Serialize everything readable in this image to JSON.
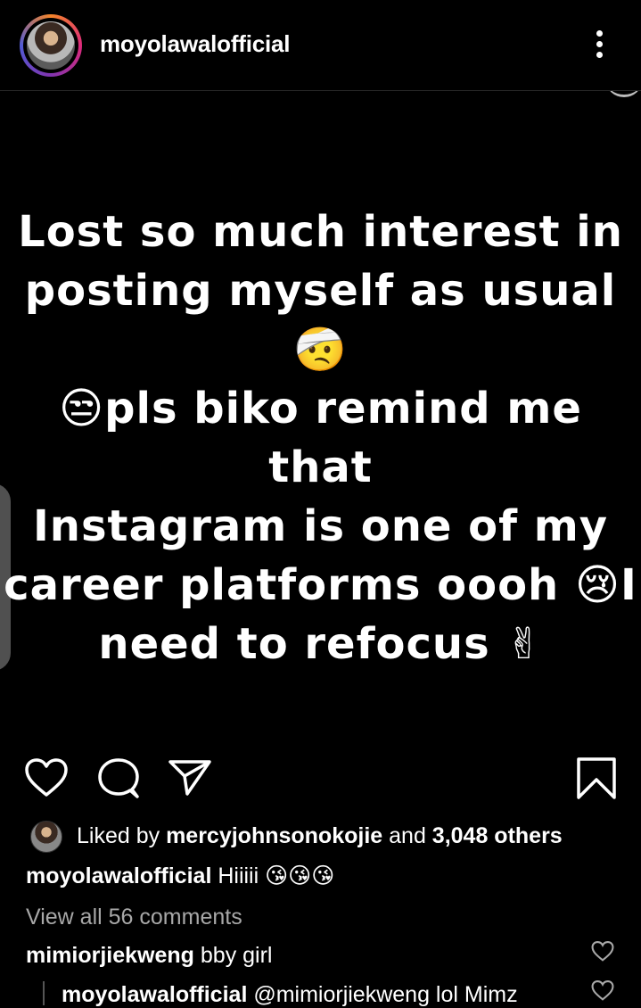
{
  "header": {
    "username": "moyolawalofficial",
    "more_icon": "more-vertical-icon"
  },
  "post": {
    "lines": [
      "Lost so much interest in",
      "posting myself as usual 🤕",
      "😒pls biko remind me that",
      "Instagram is one of my",
      "career platforms oooh 😢I",
      "need to refocus ✌"
    ]
  },
  "actions": {
    "like_icon": "heart-icon",
    "comment_icon": "comment-icon",
    "share_icon": "send-icon",
    "save_icon": "bookmark-icon"
  },
  "likes": {
    "prefix": "Liked by ",
    "user": "mercyjohnsonokojie",
    "middle": " and ",
    "count": "3,048 others"
  },
  "caption": {
    "user": "moyolawalofficial",
    "text": " Hiiiii 😘😘😘"
  },
  "view_all": "View all 56 comments",
  "comments": [
    {
      "user": "mimiorjiekweng",
      "text": " bby girl"
    },
    {
      "user": "moyolawalofficial",
      "text": " @mimiorjiekweng lol Mimz"
    }
  ]
}
